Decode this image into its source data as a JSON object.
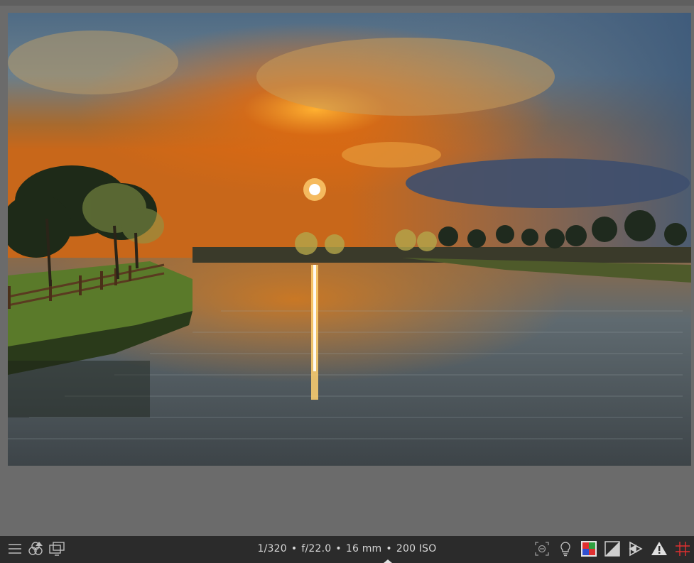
{
  "photo": {
    "description_icon": "image-preview"
  },
  "bottom_bar": {
    "exif": {
      "shutter": "1/320",
      "aperture": "f/22.0",
      "focal_length": "16 mm",
      "iso": "200 ISO",
      "separator": "•"
    },
    "left_icons": [
      "menu-icon",
      "styles-icon",
      "display-icon"
    ],
    "right_icons": [
      "focus-peaking-icon",
      "lightbulb-icon",
      "color-assessment-icon",
      "clipping-icon",
      "softproof-icon",
      "gamut-warning-icon",
      "guides-icon"
    ]
  },
  "colors": {
    "background": "#6b6b6b",
    "toolbar": "#2b2b2b",
    "icon": "#bdbdbd",
    "accent_red": "#e03030"
  }
}
